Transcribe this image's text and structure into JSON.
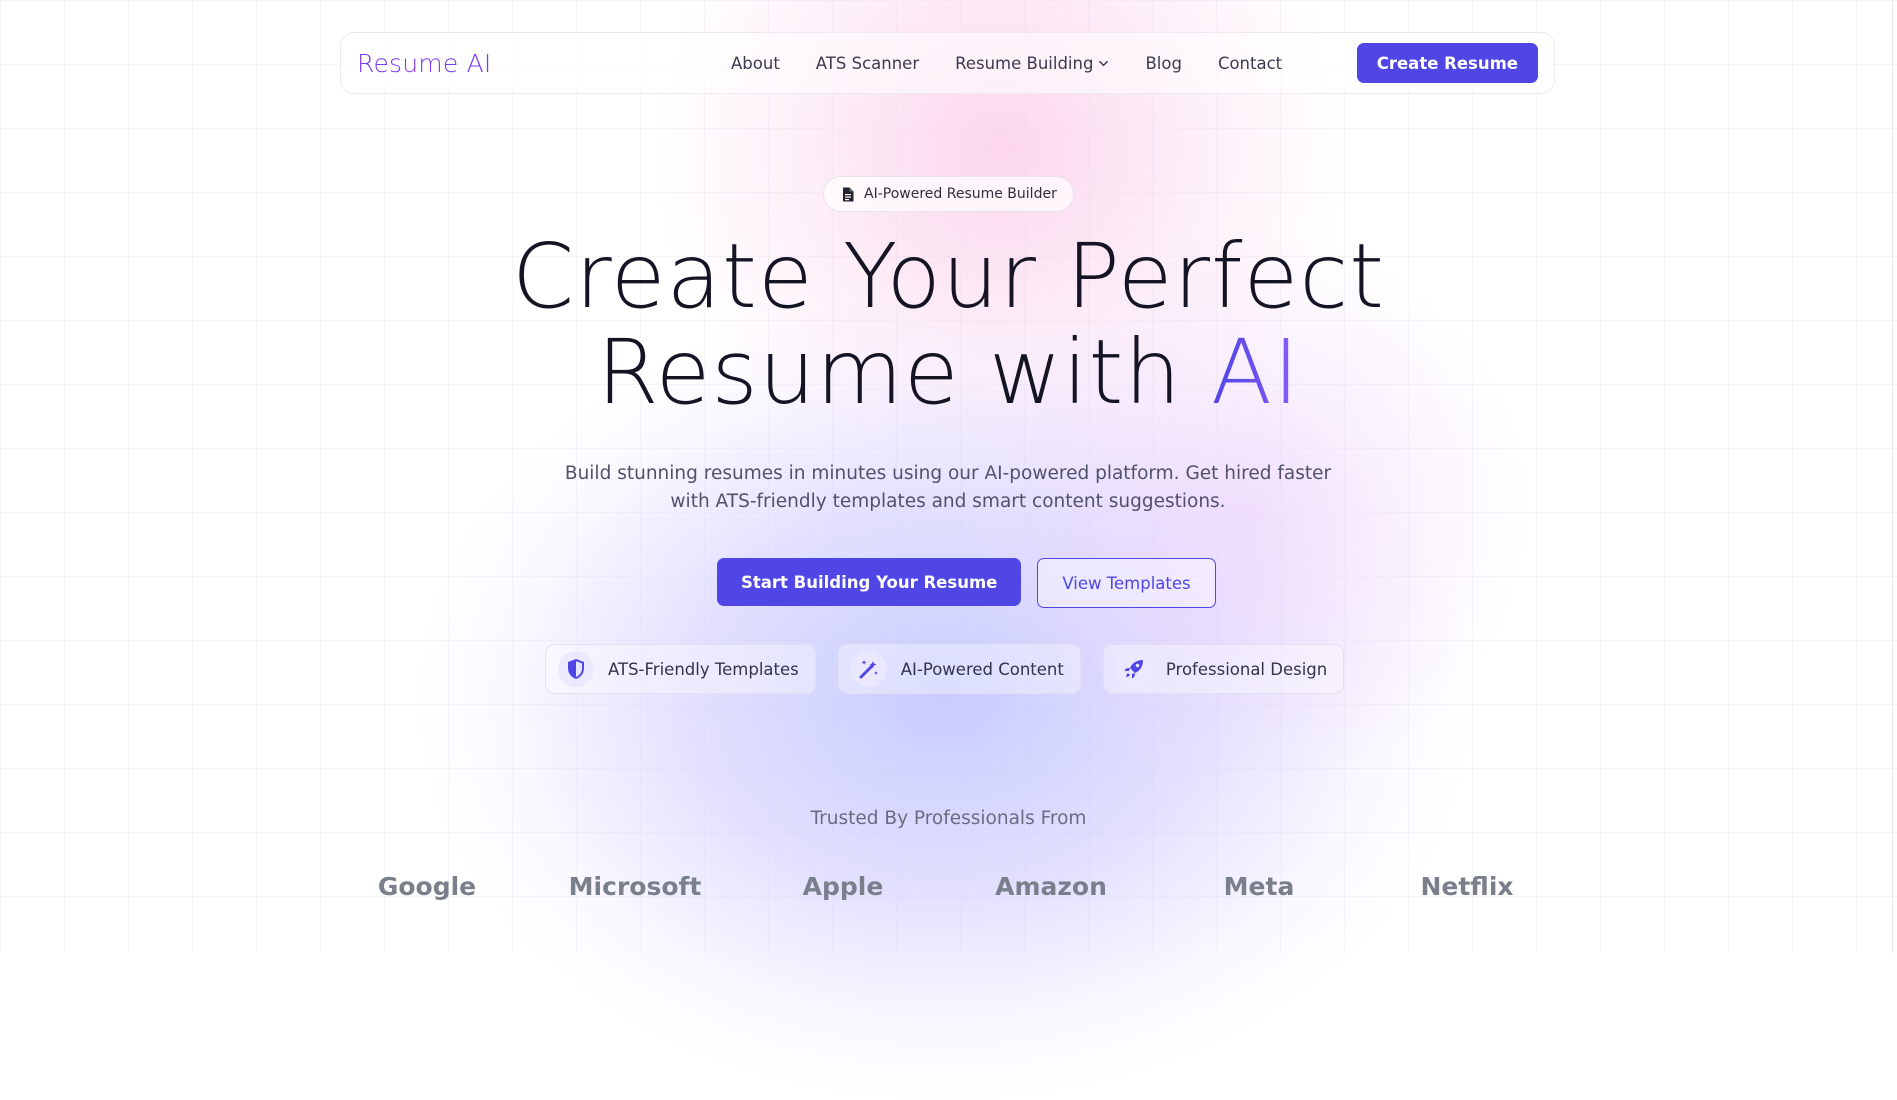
{
  "nav": {
    "brand": "Resume AI",
    "links": [
      "About",
      "ATS Scanner",
      "Resume Building",
      "Blog",
      "Contact"
    ],
    "cta": "Create Resume"
  },
  "hero": {
    "badge": "AI-Powered Resume Builder",
    "title_line1": "Create Your Perfect",
    "title_line2_prefix": "Resume with ",
    "title_accent": "AI",
    "subtitle_line1": "Build stunning resumes in minutes using our AI-powered platform. Get hired faster",
    "subtitle_line2": "with ATS-friendly templates and smart content suggestions.",
    "primary_cta": "Start Building Your Resume",
    "secondary_cta": "View Templates",
    "features": [
      {
        "label": "ATS-Friendly Templates",
        "icon": "shield-icon"
      },
      {
        "label": "AI-Powered Content",
        "icon": "magic-wand-icon"
      },
      {
        "label": "Professional Design",
        "icon": "rocket-icon"
      }
    ]
  },
  "trusted": {
    "title": "Trusted By Professionals From",
    "companies": [
      "Google",
      "Microsoft",
      "Apple",
      "Amazon",
      "Meta",
      "Netflix"
    ]
  },
  "colors": {
    "accent": "#4f46e5",
    "brand": "#7c3aed",
    "logo_gray": "#7a7f8c"
  }
}
